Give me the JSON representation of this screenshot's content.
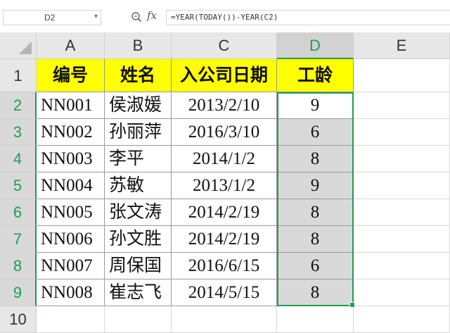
{
  "formula_bar": {
    "name_box": "D2",
    "formula": "=YEAR(TODAY())-YEAR(C2)"
  },
  "columns": [
    "A",
    "B",
    "C",
    "D",
    "E"
  ],
  "selected_column": "D",
  "rows": [
    "1",
    "2",
    "3",
    "4",
    "5",
    "6",
    "7",
    "8",
    "9",
    "10"
  ],
  "header_row": [
    "编号",
    "姓名",
    "入公司日期",
    "工龄"
  ],
  "table": [
    [
      "NN001",
      "侯淑媛",
      "2013/2/10",
      "9"
    ],
    [
      "NN002",
      "孙丽萍",
      "2016/3/10",
      "6"
    ],
    [
      "NN003",
      "李平",
      "2014/1/2",
      "8"
    ],
    [
      "NN004",
      "苏敏",
      "2013/1/2",
      "9"
    ],
    [
      "NN005",
      "张文涛",
      "2014/2/19",
      "8"
    ],
    [
      "NN006",
      "孙文胜",
      "2014/2/19",
      "8"
    ],
    [
      "NN007",
      "周保国",
      "2016/6/15",
      "6"
    ],
    [
      "NN008",
      "崔志飞",
      "2014/5/15",
      "8"
    ]
  ],
  "colors": {
    "header_fill": "#ffff00",
    "selection": "#1f9d55",
    "selected_fill": "#d9d9d9"
  }
}
